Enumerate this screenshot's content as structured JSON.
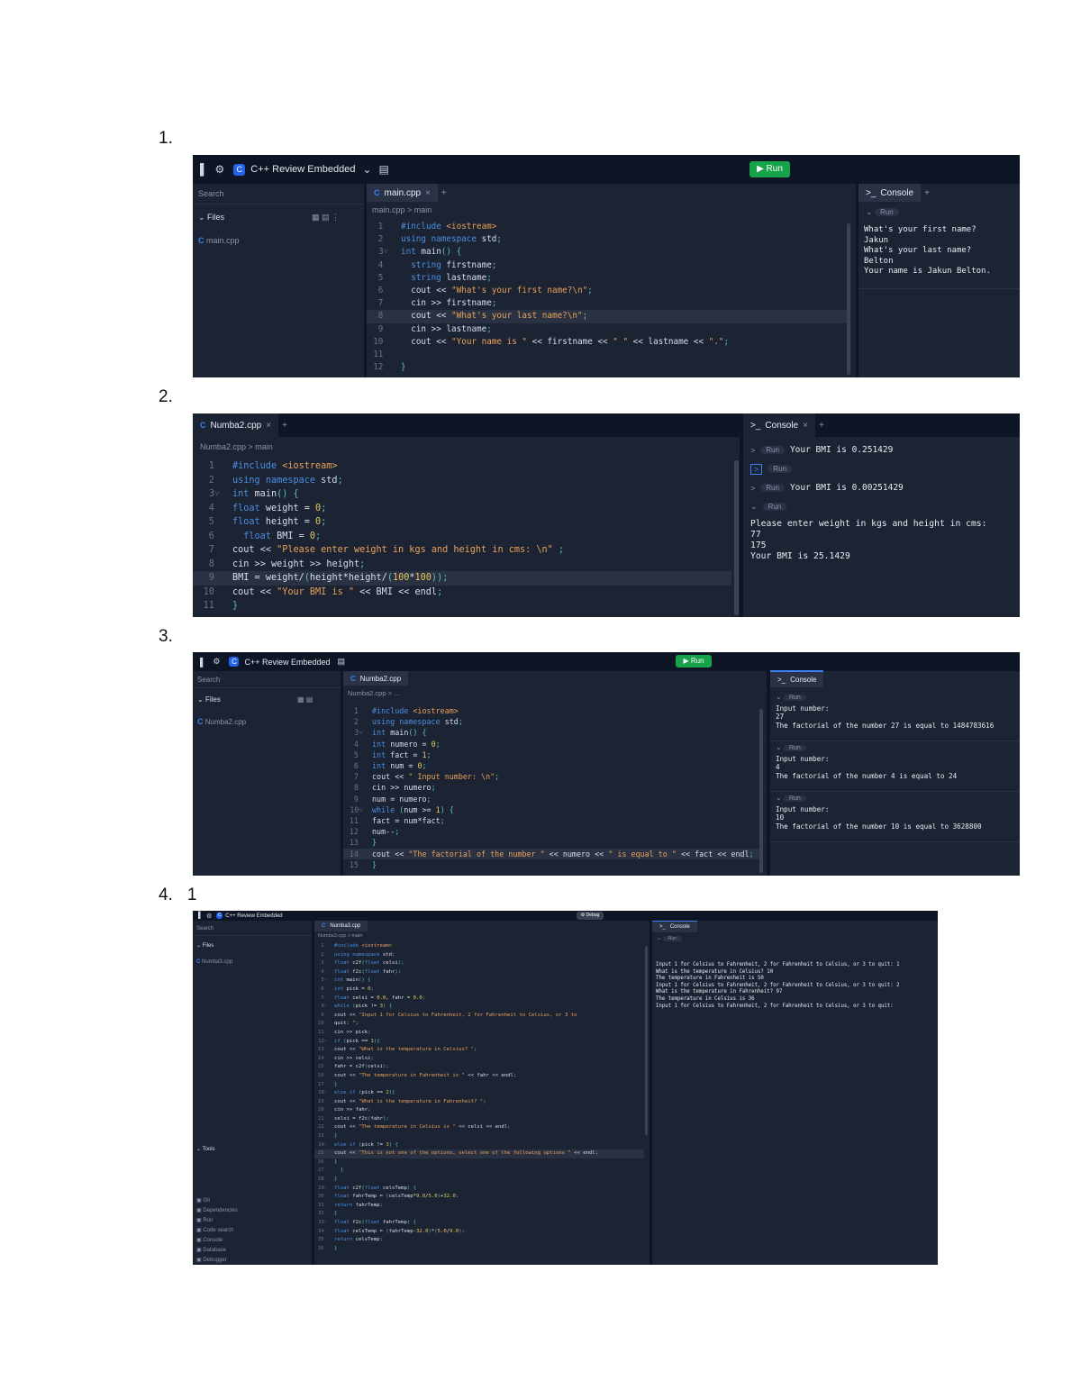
{
  "steps": [
    {
      "number": "1."
    },
    {
      "number": "2."
    },
    {
      "number": "3."
    },
    {
      "number": "4.",
      "extra": "1"
    }
  ],
  "shot1": {
    "workspace": "C++ Review Embedded",
    "run_label": "Run",
    "search_placeholder": "Search",
    "files_label": "Files",
    "file_name": "main.cpp",
    "tab": "main.cpp",
    "breadcrumb": "main.cpp > main",
    "console_tab": "Console",
    "run_pill": "Run",
    "code": [
      "#include <iostream>",
      "using namespace std;",
      "int main() {",
      "  string firstname;",
      "  string lastname;",
      "  cout << \"What's your first name?\\n\";",
      "  cin >> firstname;",
      "  cout << \"What's your last name?\\n\";",
      "  cin >> lastname;",
      "  cout << \"Your name is \" << firstname << \" \" << lastname << \".\";",
      "",
      "}"
    ],
    "console_output": [
      "What's your first name?",
      "Jakun",
      "What's your last name?",
      "Belton",
      "Your name is Jakun Belton."
    ]
  },
  "shot2": {
    "tab": "Numba2.cpp",
    "breadcrumb": "Numba2.cpp > main",
    "console_tab": "Console",
    "code": [
      "#include <iostream>",
      "using namespace std;",
      "int main() {",
      "float weight = 0;",
      "float height = 0;",
      "  float BMI = 0;",
      "cout << \"Please enter weight in kgs and height in cms: \\n\" ;",
      "cin >> weight >> height;",
      "BMI = weight/(height*height/(100*100));",
      "cout << \"Your BMI is \" << BMI << endl;",
      "}"
    ],
    "runs": [
      {
        "label": "Run",
        "text": "Your BMI is 0.251429"
      },
      {
        "label": "Run",
        "text": ""
      },
      {
        "label": "Run",
        "text": "Your BMI is 0.00251429"
      },
      {
        "label": "Run",
        "text": ""
      }
    ],
    "console_output": [
      "Please enter weight in kgs and height in cms:",
      "77",
      "175",
      "Your BMI is 25.1429"
    ]
  },
  "shot3": {
    "workspace": "C++ Review Embedded",
    "run_label": "Run",
    "search_placeholder": "Search",
    "files_label": "Files",
    "file_name": "Numba2.cpp",
    "tab": "Numba2.cpp",
    "breadcrumb": "Numba2.cpp > ...",
    "console_tab": "Console",
    "run_pill": "Run",
    "code": [
      "#include <iostream>",
      "using namespace std;",
      "int main() {",
      "int numero = 0;",
      "int fact = 1;",
      "int num = 0;",
      "cout << \" Input number: \\n\";",
      "cin >> numero;",
      "num = numero;",
      "while (num >= 1) {",
      "fact = num*fact;",
      "num--;",
      "}",
      "cout << \"The factorial of the number \" << numero << \" is equal to \" << fact << endl;",
      "}"
    ],
    "console_blocks": [
      [
        "Input number:",
        "27",
        "The factorial of the number 27 is equal to 1484783616"
      ],
      [
        "Input number:",
        "4",
        "The factorial of the number 4 is equal to 24"
      ],
      [
        "Input number:",
        "10",
        "The factorial of the number 10 is equal to 3628800"
      ]
    ]
  },
  "shot4": {
    "workspace": "C++ Review Embedded",
    "run_label": "Debug",
    "search_placeholder": "Search",
    "files_label": "Files",
    "file_name": "Numba3.cpp",
    "tab": "Numba3.cpp",
    "breadcrumb": "Numba3.cpp > main",
    "console_tab": "Console",
    "run_pill": "Run",
    "tools_label": "Tools",
    "tools": [
      "Git",
      "Dependencies",
      "Run",
      "Code search",
      "Console",
      "Database",
      "Debugger"
    ],
    "code": [
      "#include <iostream>",
      "using namespace std;",
      "float c2f(float celsi);",
      "float f2c(float fahr);",
      "int main() {",
      "int pick = 0;",
      "float celsi = 0.0, fahr = 0.0;",
      "while (pick != 3) {",
      "cout << \"Input 1 for Celsius to Fahrenheit, 2 for Fahrenheit to Celsius, or 3 to",
      "quit: \";",
      "cin >> pick;",
      "if (pick == 1){",
      "cout << \"What is the temperature in Celsius? \";",
      "cin >> celsi;",
      "fahr = c2f(celsi);",
      "cout << \"The temperature in Fahrenheit is \" << fahr << endl;",
      "}",
      "else if (pick == 2){",
      "cout << \"What is the temperature in Fahrenheit? \";",
      "cin >> fahr;",
      "celsi = f2c(fahr);",
      "cout << \"The temperature in Celsius is \" << celsi << endl;",
      "}",
      "else if (pick != 3) {",
      "cout << \"This is not one of the options, select one of the following options \" << endl;",
      "}",
      "  }",
      "}",
      "float c2f(float celsTemp) {",
      "float fahrTemp = (celsTemp*9.0/5.0)+32.0;",
      "return fahrTemp;",
      "}",
      "float f2c(float fahrTemp) {",
      "float celsTemp = (fahrTemp-32.0)*(5.0/9.0);",
      "return celsTemp;",
      "}"
    ],
    "console_output": [
      "Input 1 for Celsius to Fahrenheit, 2 for Fahrenheit to Celsius, or 3 to quit: 1",
      "What is the temperature in Celsius? 10",
      "The temperature in Fahrenheit is 50",
      "Input 1 for Celsius to Fahrenheit, 2 for Fahrenheit to Celsius, or 3 to quit: 2",
      "What is the temperature in Fahrenheit? 97",
      "The temperature in Celsius is 36",
      "Input 1 for Celsius to Fahrenheit, 2 for Fahrenheit to Celsius, or 3 to quit: "
    ]
  }
}
